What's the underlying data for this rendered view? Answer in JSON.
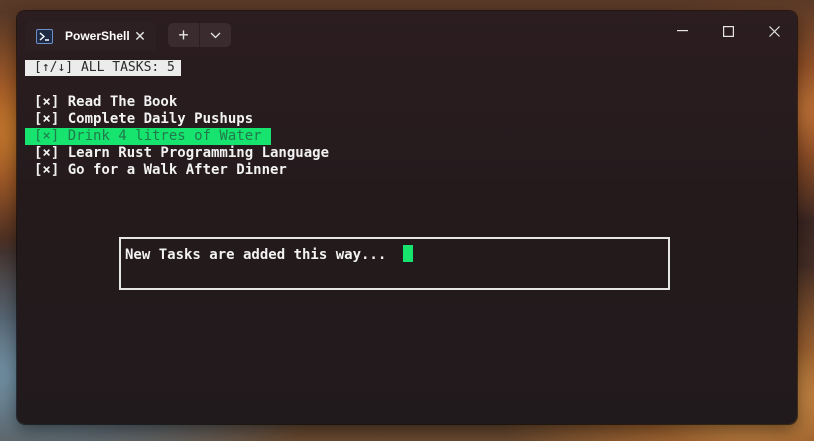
{
  "window": {
    "tab_title": "PowerShell",
    "tab_close": "✕",
    "new_tab": "+",
    "dropdown": "⌄",
    "minimize": "—",
    "maximize": "☐",
    "close": "✕"
  },
  "terminal": {
    "header": "[↑/↓] ALL TASKS: 5",
    "tasks": [
      {
        "text": "[×] Read The Book"
      },
      {
        "text": "[×] Complete Daily Pushups"
      },
      {
        "text": "[×] Drink 4 litres of Water"
      },
      {
        "text": "[×] Learn Rust Programming Language"
      },
      {
        "text": "[×] Go for a Walk After Dinner"
      }
    ],
    "selected_index": 2,
    "input_text": "New Tasks are added this way...",
    "accent_color": "#17e36f"
  }
}
